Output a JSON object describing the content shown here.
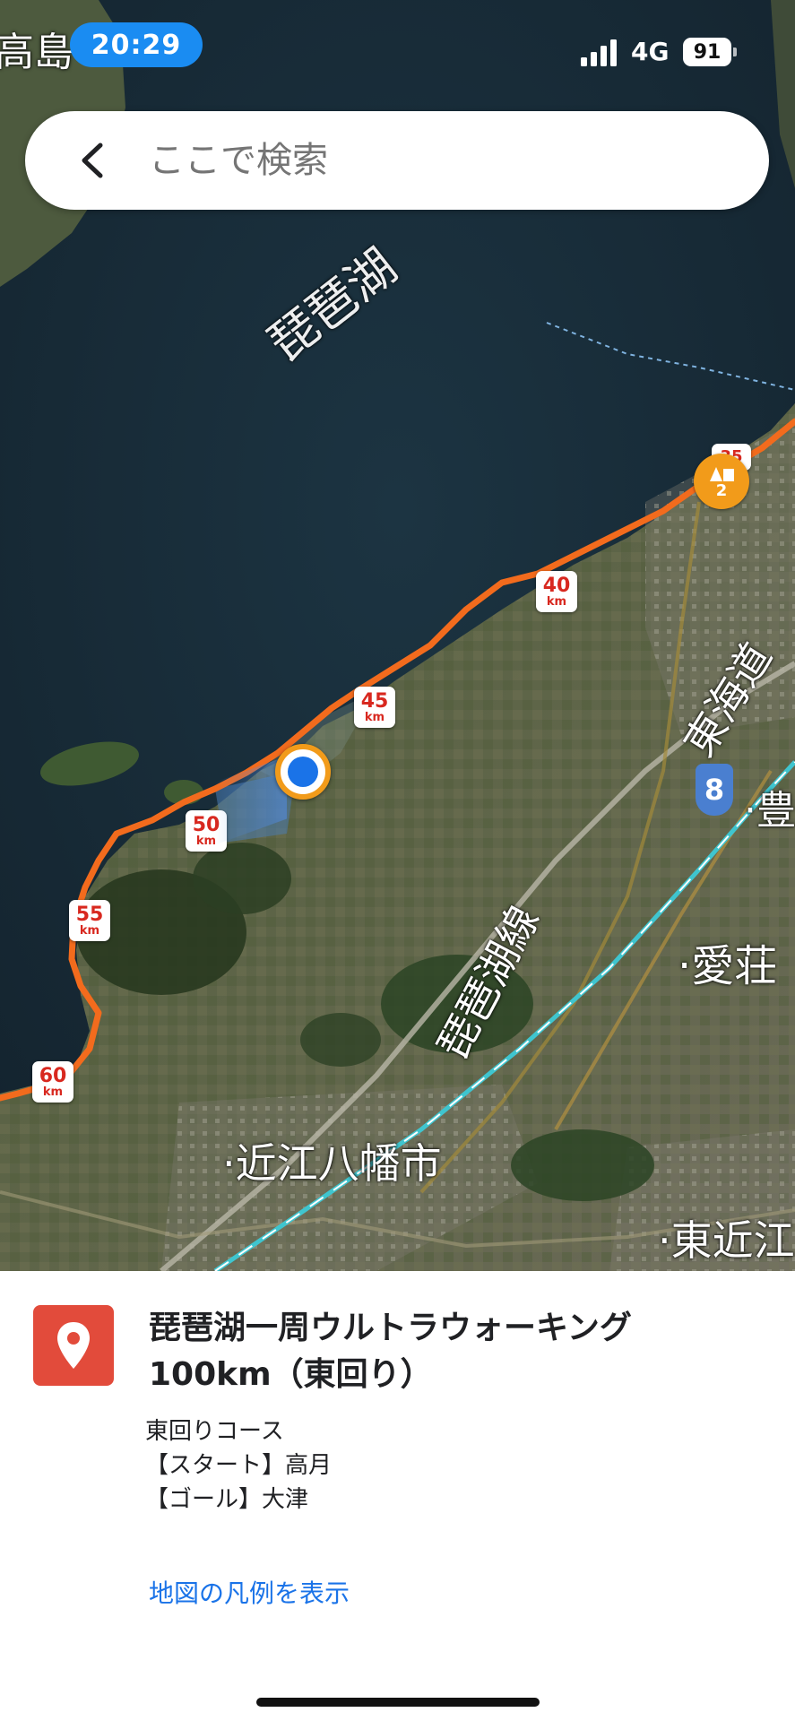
{
  "status_bar": {
    "time": "20:29",
    "network": "4G",
    "battery": "91"
  },
  "search": {
    "placeholder": "ここで検索"
  },
  "map": {
    "labels": {
      "lake": "琵琶湖",
      "takashima": "高島",
      "tokaido": "東海道",
      "biwako_line": "琵琶湖線",
      "omihachiman": "近江八幡市",
      "aisho": "愛荘",
      "higashiomi": "東近江",
      "toyo": "豊"
    },
    "km_markers": [
      {
        "num": "40",
        "unit": "km"
      },
      {
        "num": "45",
        "unit": "km"
      },
      {
        "num": "50",
        "unit": "km"
      },
      {
        "num": "55",
        "unit": "km"
      },
      {
        "num": "60",
        "unit": "km"
      }
    ],
    "waypoint_badge": "2",
    "route_shield": "8",
    "colors": {
      "route": "#f26b1d",
      "location": "#1a73e8",
      "rail": "#3fc5cf"
    }
  },
  "place": {
    "title_line1": "琵琶湖一周ウルトラウォーキング",
    "title_line2": "100km（東回り）",
    "description": [
      "東回りコース",
      "【スタート】高月",
      "【ゴール】大津"
    ],
    "legend_link": "地図の凡例を表示"
  }
}
